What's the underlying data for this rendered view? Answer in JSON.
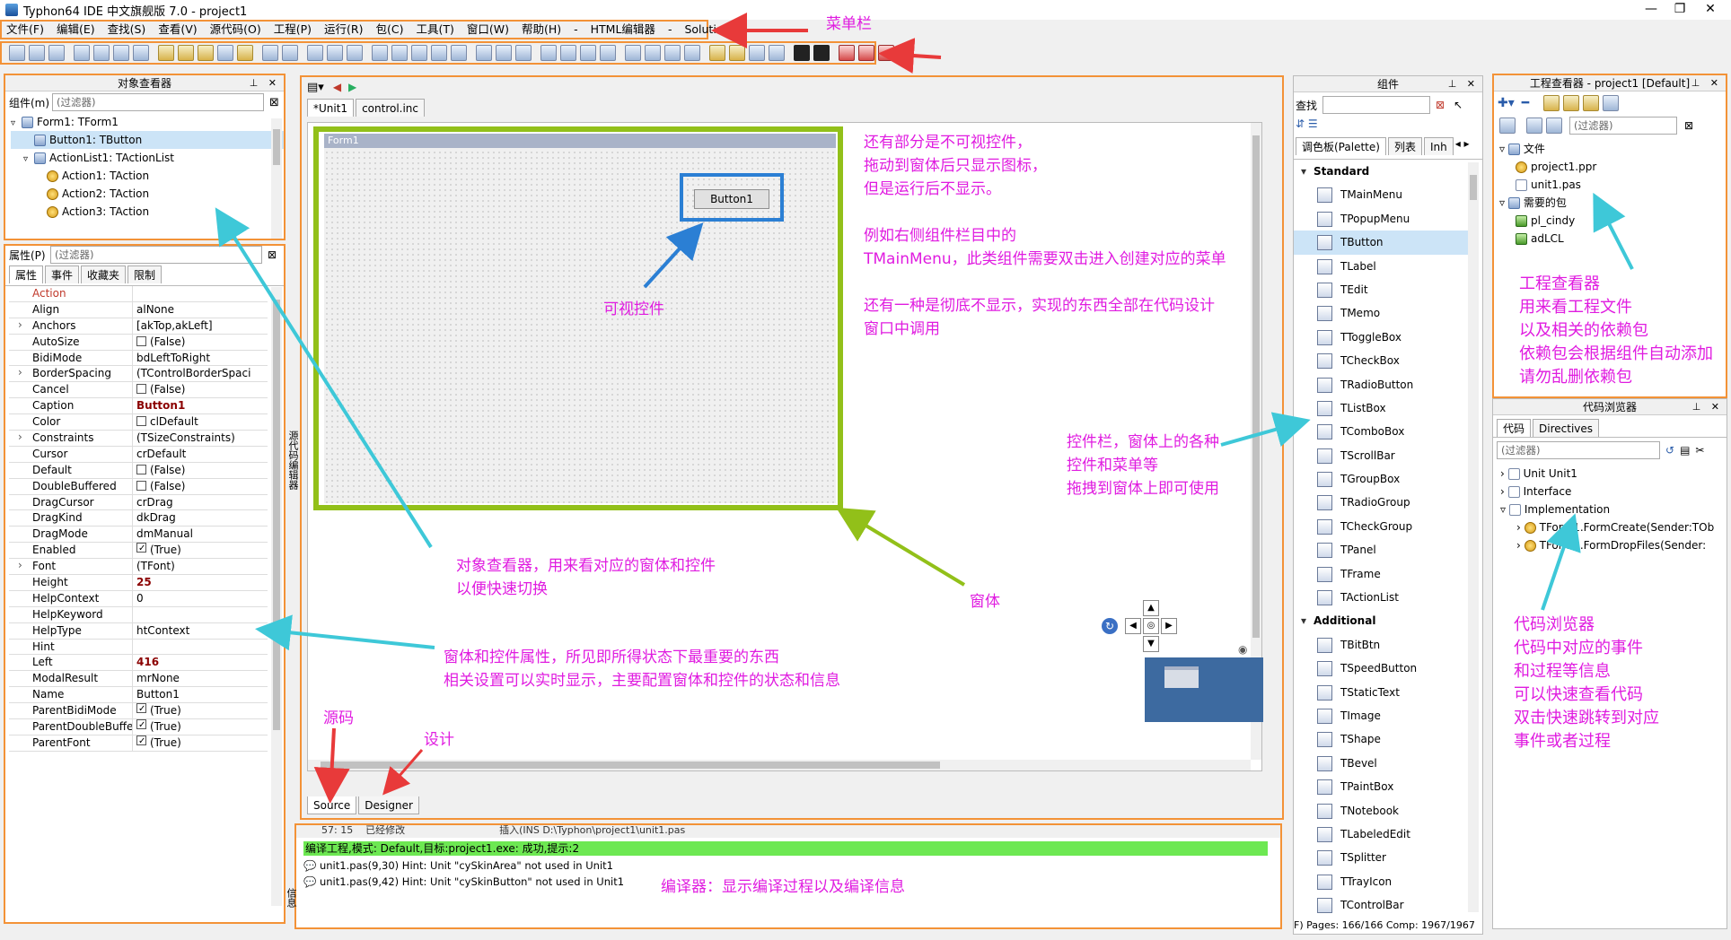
{
  "window": {
    "title": "Typhon64 IDE 中文旗舰版 7.0 - project1",
    "minimize": "—",
    "maximize": "❐",
    "close": "✕"
  },
  "menu": [
    "文件(F)",
    "编辑(E)",
    "查找(S)",
    "查看(V)",
    "源代码(O)",
    "工程(P)",
    "运行(R)",
    "包(C)",
    "工具(T)",
    "窗口(W)",
    "帮助(H)",
    "-",
    "HTML编辑器",
    "-",
    "Solutions"
  ],
  "object_inspector": {
    "title": "对象查看器",
    "component_label": "组件(m)",
    "filter_placeholder": "(过滤器)",
    "tree": [
      {
        "label": "Form1: TForm1",
        "level": 0
      },
      {
        "label": "Button1: TButton",
        "level": 1,
        "selected": true
      },
      {
        "label": "ActionList1: TActionList",
        "level": 1
      },
      {
        "label": "Action1: TAction",
        "level": 2
      },
      {
        "label": "Action2: TAction",
        "level": 2
      },
      {
        "label": "Action3: TAction",
        "level": 2
      }
    ],
    "props_label": "属性(P)",
    "props_filter_placeholder": "(过滤器)",
    "tabs": [
      "属性",
      "事件",
      "收藏夹",
      "限制"
    ],
    "properties": [
      {
        "name": "Action",
        "value": "",
        "red": true
      },
      {
        "name": "Align",
        "value": "alNone"
      },
      {
        "name": "Anchors",
        "value": "[akTop,akLeft]",
        "expand": true
      },
      {
        "name": "AutoSize",
        "value": "(False)",
        "check": "off"
      },
      {
        "name": "BidiMode",
        "value": "bdLeftToRight"
      },
      {
        "name": "BorderSpacing",
        "value": "(TControlBorderSpaci",
        "expand": true
      },
      {
        "name": "Cancel",
        "value": "(False)",
        "check": "off"
      },
      {
        "name": "Caption",
        "value": "Button1",
        "bold": true
      },
      {
        "name": "Color",
        "value": "clDefault",
        "check": "off"
      },
      {
        "name": "Constraints",
        "value": "(TSizeConstraints)",
        "expand": true
      },
      {
        "name": "Cursor",
        "value": "crDefault"
      },
      {
        "name": "Default",
        "value": "(False)",
        "check": "off"
      },
      {
        "name": "DoubleBuffered",
        "value": "(False)",
        "check": "off"
      },
      {
        "name": "DragCursor",
        "value": "crDrag"
      },
      {
        "name": "DragKind",
        "value": "dkDrag"
      },
      {
        "name": "DragMode",
        "value": "dmManual"
      },
      {
        "name": "Enabled",
        "value": "(True)",
        "check": "on"
      },
      {
        "name": "Font",
        "value": "(TFont)",
        "expand": true
      },
      {
        "name": "Height",
        "value": "25",
        "bold": true
      },
      {
        "name": "HelpContext",
        "value": "0"
      },
      {
        "name": "HelpKeyword",
        "value": ""
      },
      {
        "name": "HelpType",
        "value": "htContext"
      },
      {
        "name": "Hint",
        "value": ""
      },
      {
        "name": "Left",
        "value": "416",
        "bold": true
      },
      {
        "name": "ModalResult",
        "value": "mrNone"
      },
      {
        "name": "Name",
        "value": "Button1"
      },
      {
        "name": "ParentBidiMode",
        "value": "(True)",
        "check": "on"
      },
      {
        "name": "ParentDoubleBuffered",
        "value": "(True)",
        "check": "on"
      },
      {
        "name": "ParentFont",
        "value": "(True)",
        "check": "on"
      }
    ]
  },
  "editor": {
    "file_tabs": [
      "*Unit1",
      "control.inc"
    ],
    "form_caption": "Form1",
    "button_caption": "Button1",
    "bottom_tabs": [
      "Source",
      "Designer"
    ],
    "side_label": "源代码编辑器"
  },
  "messages": {
    "header_line": "57: 15    已经修改                              插入(INS D:\\Typhon\\project1\\unit1.pas",
    "success": "编译工程,模式: Default,目标:project1.exe: 成功,提示:2",
    "lines": [
      "unit1.pas(9,30) Hint: Unit \"cySkinArea\" not used in Unit1",
      "unit1.pas(9,42) Hint: Unit \"cySkinButton\" not used in Unit1"
    ],
    "side_label": "信息"
  },
  "palette": {
    "title": "组件",
    "find_label": "查找",
    "tabs": [
      "调色板(Palette)",
      "列表",
      "Inh"
    ],
    "items": [
      {
        "label": "Standard",
        "cat": true
      },
      {
        "label": "TMainMenu"
      },
      {
        "label": "TPopupMenu"
      },
      {
        "label": "TButton",
        "selected": true
      },
      {
        "label": "TLabel"
      },
      {
        "label": "TEdit"
      },
      {
        "label": "TMemo"
      },
      {
        "label": "TToggleBox"
      },
      {
        "label": "TCheckBox"
      },
      {
        "label": "TRadioButton"
      },
      {
        "label": "TListBox"
      },
      {
        "label": "TComboBox"
      },
      {
        "label": "TScrollBar"
      },
      {
        "label": "TGroupBox"
      },
      {
        "label": "TRadioGroup"
      },
      {
        "label": "TCheckGroup"
      },
      {
        "label": "TPanel"
      },
      {
        "label": "TFrame"
      },
      {
        "label": "TActionList"
      },
      {
        "label": "Additional",
        "cat": true
      },
      {
        "label": "TBitBtn"
      },
      {
        "label": "TSpeedButton"
      },
      {
        "label": "TStaticText"
      },
      {
        "label": "TImage"
      },
      {
        "label": "TShape"
      },
      {
        "label": "TBevel"
      },
      {
        "label": "TPaintBox"
      },
      {
        "label": "TNotebook"
      },
      {
        "label": "TLabeledEdit"
      },
      {
        "label": "TSplitter"
      },
      {
        "label": "TTrayIcon"
      },
      {
        "label": "TControlBar"
      }
    ],
    "status": "F) Pages: 166/166  Comp: 1967/1967"
  },
  "project_inspector": {
    "title": "工程查看器 - project1 [Default]",
    "filter_placeholder": "(过滤器)",
    "tree": [
      {
        "label": "文件",
        "level": 0,
        "icon": "folder"
      },
      {
        "label": "project1.ppr",
        "level": 1,
        "icon": "gear"
      },
      {
        "label": "unit1.pas",
        "level": 1,
        "icon": "file"
      },
      {
        "label": "需要的包",
        "level": 0,
        "icon": "folder"
      },
      {
        "label": "pl_cindy",
        "level": 1,
        "icon": "pkg"
      },
      {
        "label": "adLCL",
        "level": 1,
        "icon": "pkg"
      }
    ]
  },
  "code_browser": {
    "title": "代码浏览器",
    "tabs": [
      "代码",
      "Directives"
    ],
    "filter_placeholder": "(过滤器)",
    "tree": [
      {
        "label": "Unit Unit1",
        "level": 0
      },
      {
        "label": "Interface",
        "level": 0
      },
      {
        "label": "Implementation",
        "level": 0
      },
      {
        "label": "TForm1.FormCreate(Sender:TOb",
        "level": 1
      },
      {
        "label": "TForm1.FormDropFiles(Sender:",
        "level": 1
      }
    ]
  },
  "annotations": {
    "menubar": "菜单栏",
    "invisible": [
      "还有部分是不可视控件，",
      "拖动到窗体后只显示图标，",
      "但是运行后不显示。",
      "",
      "例如右侧组件栏目中的",
      "TMainMenu，此类组件需要双击进入创建对应的菜单",
      "",
      "还有一种是彻底不显示，实现的东西全部在代码设计",
      "窗口中调用"
    ],
    "visible_control": "可视控件",
    "project_viewer": [
      "工程查看器",
      "用来看工程文件",
      "以及相关的依赖包",
      "依赖包会根据组件自动添加",
      "请勿乱删依赖包"
    ],
    "palette_desc": [
      "控件栏，窗体上的各种",
      "控件和菜单等",
      "拖拽到窗体上即可使用"
    ],
    "object_viewer": [
      "对象查看器，用来看对应的窗体和控件",
      "以便快速切换"
    ],
    "form": "窗体",
    "properties": [
      "窗体和控件属性，所见即所得状态下最重要的东西",
      "相关设置可以实时显示，主要配置窗体和控件的状态和信息"
    ],
    "source": "源码",
    "design": "设计",
    "compiler": "编译器：显示编译过程以及编译信息",
    "code_browser": [
      "代码浏览器",
      "代码中对应的事件",
      "和过程等信息",
      "可以快速查看代码",
      "双击快速跳转到对应",
      "事件或者过程"
    ]
  }
}
